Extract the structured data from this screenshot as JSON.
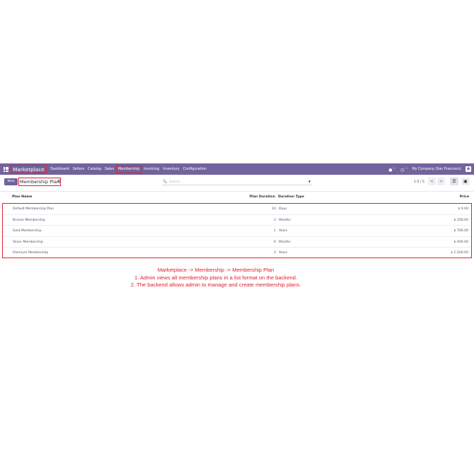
{
  "navbar": {
    "app_name": "Marketplace",
    "menu": [
      "Dashboard",
      "Sellers",
      "Catalog",
      "Sales",
      "Membership",
      "Invoicing",
      "Inventory",
      "Configuration"
    ],
    "active_menu": "Membership",
    "messages_count": "11",
    "activities_count": "11",
    "company": "My Company (San Francisco)",
    "bg_color": "#71639e",
    "highlight_color": "#e0202f",
    "icons": [
      "apps-grid-icon",
      "chat-icon",
      "clock-icon",
      "avatar-icon"
    ]
  },
  "control": {
    "new_label": "New",
    "breadcrumb": "Membership Plan",
    "gear_icon": "gear-icon",
    "search_placeholder": "Search...",
    "pager": "1-5 / 5",
    "prev": "<",
    "next": ">",
    "views": [
      "list-view-icon",
      "kanban-view-icon"
    ]
  },
  "table": {
    "headers": {
      "name": "Plan Name",
      "duration": "Plan Duration",
      "duration_type": "Duration Type",
      "price": "Price"
    },
    "rows": [
      {
        "name": "Default Membership Plan",
        "duration": "10",
        "duration_type": "Days",
        "price": "$ 0.00"
      },
      {
        "name": "Bronze Membership",
        "duration": "2",
        "duration_type": "Months",
        "price": "$ 200.00"
      },
      {
        "name": "Gold Membership",
        "duration": "1",
        "duration_type": "Years",
        "price": "$ 700.00"
      },
      {
        "name": "Silver Membership",
        "duration": "6",
        "duration_type": "Months",
        "price": "$ 400.00"
      },
      {
        "name": "Premium Membership",
        "duration": "2",
        "duration_type": "Years",
        "price": "$ 1,500.00"
      }
    ]
  },
  "caption": {
    "line1": "Marketplace -> Membership -> Membership Plan",
    "line2": "1. Admin views all membership plans in a list format on the backend.",
    "line3": "2. The backend allows admin to manage and create membership plans."
  }
}
